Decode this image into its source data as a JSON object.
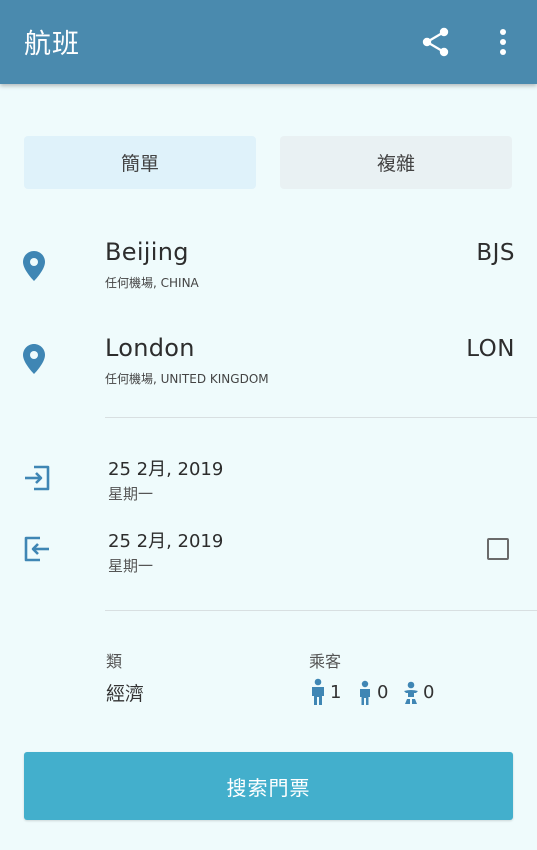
{
  "appbar": {
    "title": "航班",
    "share_icon": "share-icon",
    "more_icon": "more-vert-icon"
  },
  "mode_tabs": [
    {
      "label": "簡單",
      "selected": true
    },
    {
      "label": "複雜",
      "selected": false
    }
  ],
  "origin": {
    "city": "Beijing",
    "airport": "任何機場, CHINA",
    "code": "BJS",
    "icon": "location-pin-icon"
  },
  "destination": {
    "city": "London",
    "airport": "任何機場, UNITED KINGDOM",
    "code": "LON",
    "icon": "location-pin-icon"
  },
  "departure": {
    "date": "25 2月, 2019",
    "weekday": "星期一",
    "icon": "departure-enter-icon"
  },
  "return": {
    "date": "25 2月, 2019",
    "weekday": "星期一",
    "icon": "return-exit-icon",
    "checked": false
  },
  "cabin": {
    "label": "類",
    "value": "經濟"
  },
  "passengers": {
    "label": "乘客",
    "adults": "1",
    "children": "0",
    "infants": "0"
  },
  "search_button": {
    "label": "搜索門票"
  },
  "colors": {
    "appbar": "#4a8aae",
    "accent": "#3f86b4",
    "button": "#43afcc",
    "background": "#effbfc"
  }
}
